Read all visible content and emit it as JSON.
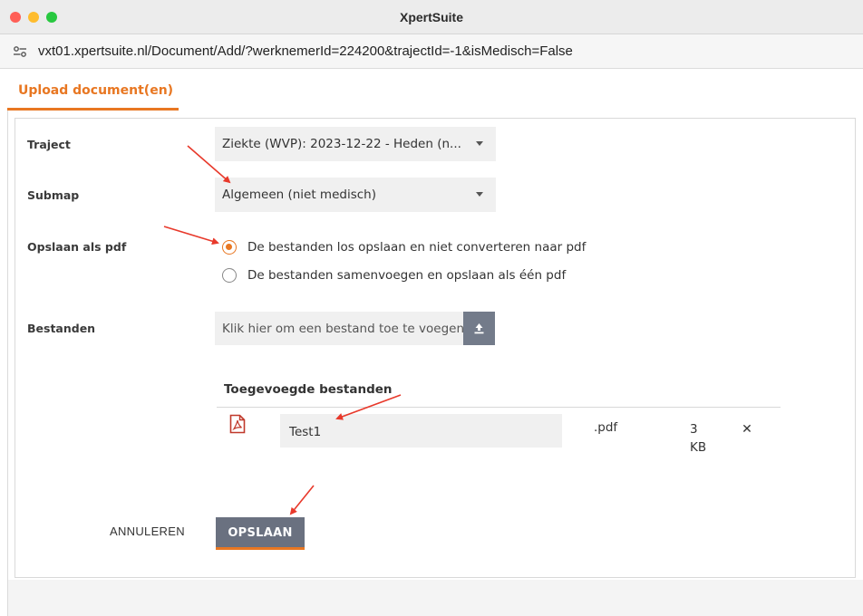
{
  "window": {
    "title": "XpertSuite"
  },
  "address_bar": {
    "url": "vxt01.xpertsuite.nl/Document/Add/?werknemerId=224200&trajectId=-1&isMedisch=False"
  },
  "tabs": [
    {
      "label": "Upload document(en)",
      "active": true
    }
  ],
  "form": {
    "traject": {
      "label": "Traject",
      "value": "Ziekte (WVP): 2023-12-22 - Heden (n..."
    },
    "submap": {
      "label": "Submap",
      "value": "Algemeen (niet medisch)"
    },
    "pdf_option": {
      "label": "Opslaan als pdf",
      "options": [
        {
          "label": "De bestanden los opslaan en niet converteren naar pdf",
          "checked": true
        },
        {
          "label": "De bestanden samenvoegen en opslaan als één pdf",
          "checked": false
        }
      ]
    },
    "files": {
      "label": "Bestanden",
      "placeholder": "Klik hier om een bestand toe te voegen",
      "added_heading": "Toegevoegde bestanden",
      "items": [
        {
          "name": "Test1",
          "extension": ".pdf",
          "size": "3 KB"
        }
      ]
    },
    "buttons": {
      "cancel": "ANNULEREN",
      "save": "OPSLAAN"
    }
  },
  "colors": {
    "accent": "#e87722",
    "button": "#6a7180",
    "annotation_arrow": "#e8392b"
  },
  "icons": [
    "site-settings-icon",
    "upload-icon",
    "pdf-file-icon",
    "close-icon",
    "chevron-down-icon"
  ]
}
